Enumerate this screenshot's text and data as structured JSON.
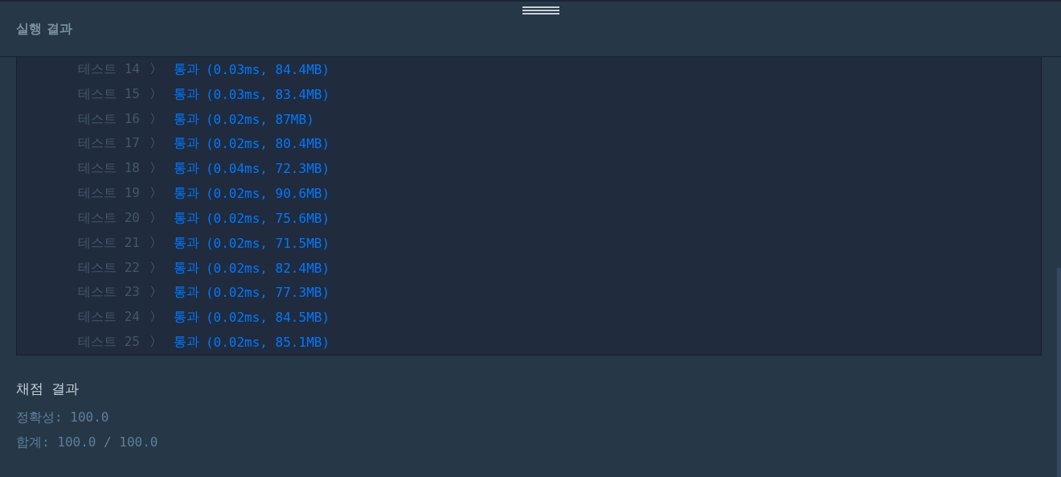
{
  "header": {
    "title": "실행 결과"
  },
  "results": [
    {
      "label": "테스트 14",
      "separator": "〉",
      "status": "통과",
      "detail": "(0.03ms, 84.4MB)"
    },
    {
      "label": "테스트 15",
      "separator": "〉",
      "status": "통과",
      "detail": "(0.03ms, 83.4MB)"
    },
    {
      "label": "테스트 16",
      "separator": "〉",
      "status": "통과",
      "detail": "(0.02ms, 87MB)"
    },
    {
      "label": "테스트 17",
      "separator": "〉",
      "status": "통과",
      "detail": "(0.02ms, 80.4MB)"
    },
    {
      "label": "테스트 18",
      "separator": "〉",
      "status": "통과",
      "detail": "(0.04ms, 72.3MB)"
    },
    {
      "label": "테스트 19",
      "separator": "〉",
      "status": "통과",
      "detail": "(0.02ms, 90.6MB)"
    },
    {
      "label": "테스트 20",
      "separator": "〉",
      "status": "통과",
      "detail": "(0.02ms, 75.6MB)"
    },
    {
      "label": "테스트 21",
      "separator": "〉",
      "status": "통과",
      "detail": "(0.02ms, 71.5MB)"
    },
    {
      "label": "테스트 22",
      "separator": "〉",
      "status": "통과",
      "detail": "(0.02ms, 82.4MB)"
    },
    {
      "label": "테스트 23",
      "separator": "〉",
      "status": "통과",
      "detail": "(0.02ms, 77.3MB)"
    },
    {
      "label": "테스트 24",
      "separator": "〉",
      "status": "통과",
      "detail": "(0.02ms, 84.5MB)"
    },
    {
      "label": "테스트 25",
      "separator": "〉",
      "status": "통과",
      "detail": "(0.02ms, 85.1MB)"
    }
  ],
  "grading": {
    "title": "채점 결과",
    "lines": [
      "정확성: 100.0",
      "합계: 100.0 / 100.0"
    ]
  }
}
